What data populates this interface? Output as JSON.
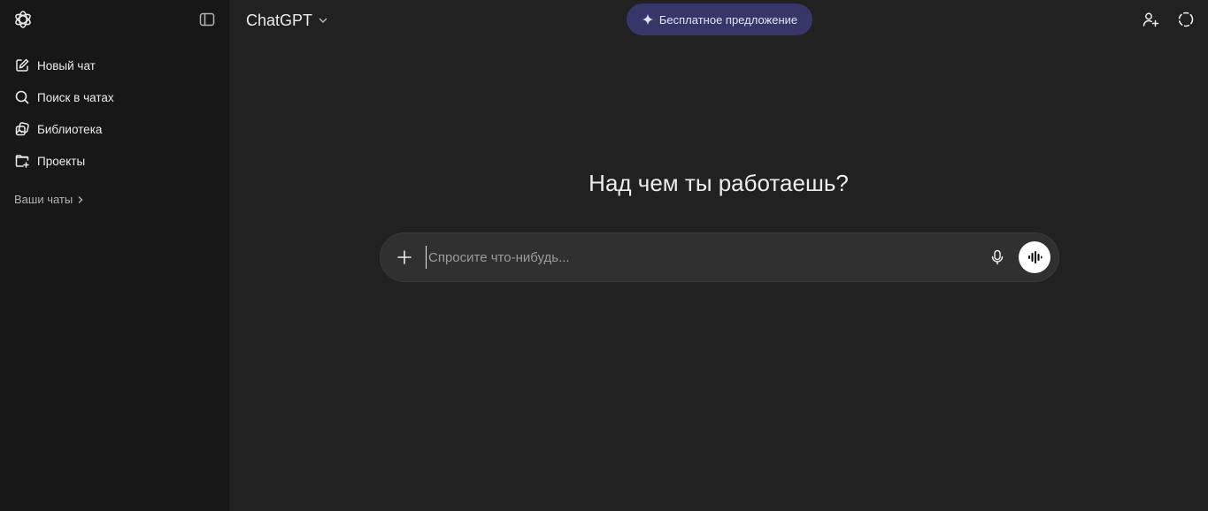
{
  "sidebar": {
    "items": [
      {
        "label": "Новый чат",
        "icon": "edit-icon"
      },
      {
        "label": "Поиск в чатах",
        "icon": "search-icon"
      },
      {
        "label": "Библиотека",
        "icon": "library-icon"
      },
      {
        "label": "Проекты",
        "icon": "folder-plus-icon"
      }
    ],
    "chats_header": "Ваши чаты"
  },
  "header": {
    "model_name": "ChatGPT",
    "promo_label": "Бесплатное предложение"
  },
  "main": {
    "headline": "Над чем ты работаешь?",
    "composer_placeholder": "Спросите что-нибудь..."
  },
  "colors": {
    "sidebar_bg": "#171717",
    "main_bg": "#212121",
    "composer_bg": "#303030",
    "promo_bg": "#373669"
  }
}
